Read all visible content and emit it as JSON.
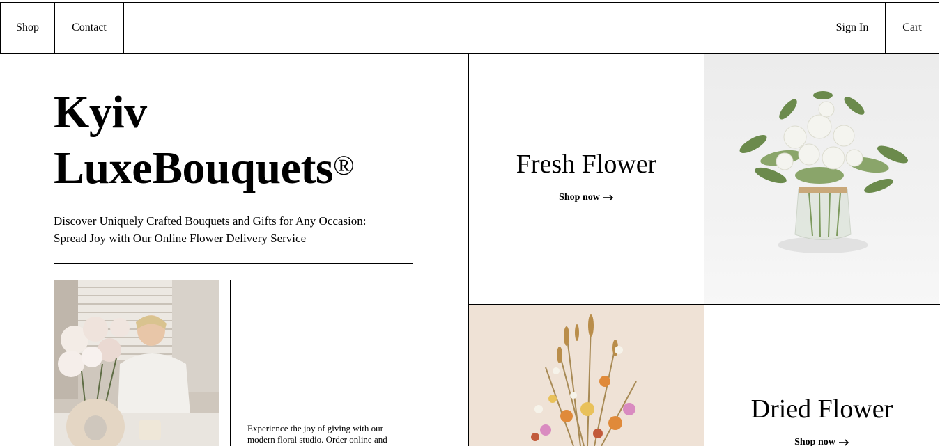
{
  "nav": {
    "shop": "Shop",
    "contact": "Contact",
    "sign_in": "Sign In",
    "cart": "Cart"
  },
  "hero": {
    "title_line1": "Kyiv",
    "title_line2": "LuxeBouquets",
    "title_mark": "®",
    "subtitle_line1": "Discover Uniquely Crafted Bouquets and Gifts for Any Occasion:",
    "subtitle_line2": "Spread Joy with Our Online Flower Delivery Service"
  },
  "experience": {
    "text": "Experience the joy of giving with our modern floral studio. Order online and"
  },
  "categories": {
    "fresh": {
      "title": "Fresh Flower",
      "cta": "Shop now"
    },
    "dried": {
      "title": "Dried Flower",
      "cta": "Shop now"
    }
  },
  "icons": {
    "arrow": "arrow-right-icon"
  }
}
